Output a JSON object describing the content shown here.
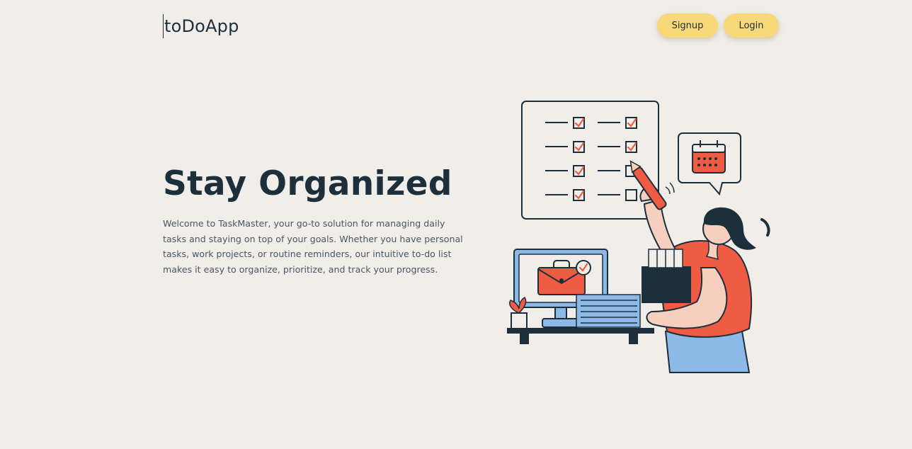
{
  "header": {
    "brand": "toDoApp",
    "signup_label": "Signup",
    "login_label": "Login"
  },
  "hero": {
    "title": "Stay Organized",
    "description": "Welcome to TaskMaster, your go-to solution for managing daily tasks and staying on top of your goals. Whether you have personal tasks, work projects, or routine reminders, our intuitive to-do list makes it easy to organize, prioritize, and track your progress."
  },
  "illustration": {
    "icon": "person-checklist-illustration"
  },
  "colors": {
    "background": "#f1eeea",
    "accent": "#f8d97a",
    "heading": "#1c2f3a",
    "illustration_red": "#ef5b43",
    "illustration_blue": "#8db9e6"
  }
}
